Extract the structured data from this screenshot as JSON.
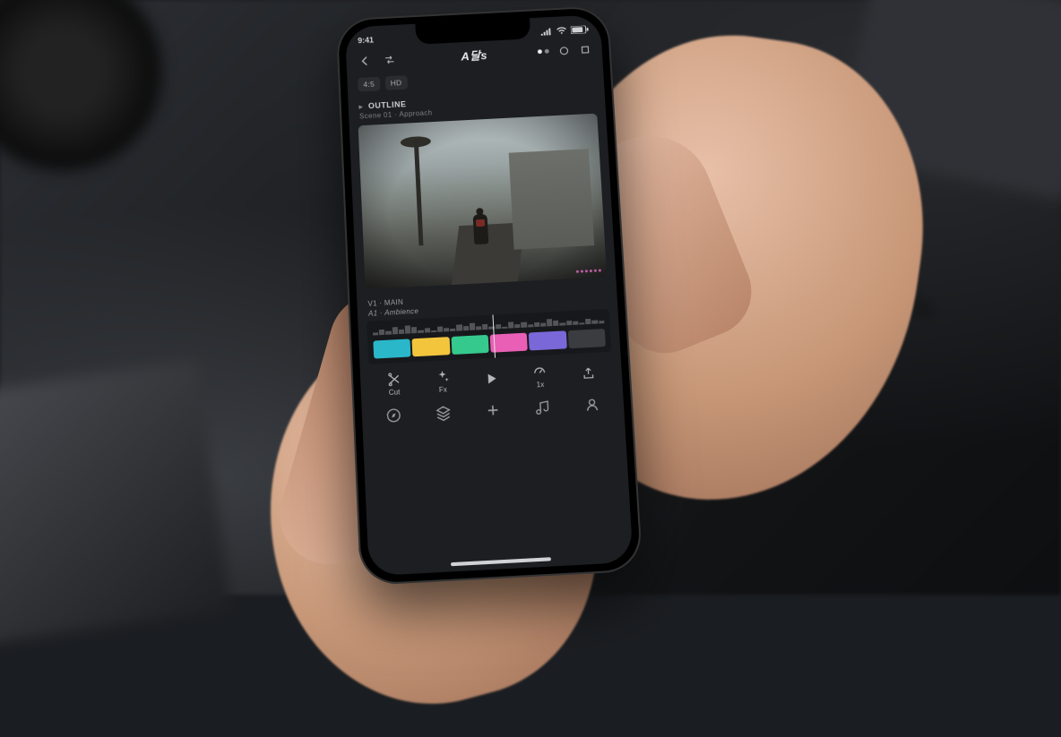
{
  "status": {
    "time": "9:41",
    "battery_pct": 85
  },
  "header": {
    "title": "A달s",
    "back_icon": "chevron-left",
    "secondary_icon": "swap",
    "dots_indicator": {
      "total": 2,
      "active": 0
    },
    "circle_icon": "circle-outline",
    "square_icon": "crop-square"
  },
  "chips": [
    "4:5",
    "HD"
  ],
  "section": {
    "label": "OUTLINE",
    "caret_icon": "chevron-right",
    "sublabel": "Scene 01 · Approach"
  },
  "preview": {
    "description": "figure walking toward ruined colonnade with palm trees at dusk",
    "overlay_dot_count": 6
  },
  "tracks": {
    "line1": "V1 · MAIN",
    "line2": "A1 · Ambience"
  },
  "timeline": {
    "clips": [
      {
        "color": "#2ab7c9"
      },
      {
        "color": "#f2c53d"
      },
      {
        "color": "#36c98e"
      },
      {
        "color": "#e85fb5"
      },
      {
        "color": "#7a68d8"
      },
      {
        "color": "#3a3c40"
      }
    ],
    "playhead_pct": 52,
    "waveform_heights": [
      3,
      6,
      4,
      8,
      5,
      9,
      7,
      3,
      5,
      2,
      6,
      4,
      3,
      7,
      5,
      8,
      4,
      6,
      3,
      5,
      2,
      7,
      4,
      6,
      3,
      5,
      4,
      8,
      6,
      3,
      5,
      4,
      2,
      6,
      4,
      3
    ]
  },
  "tools": [
    {
      "id": "cut",
      "label": "Cut",
      "icon": "scissors"
    },
    {
      "id": "fx",
      "label": "Fx",
      "icon": "sparkle"
    },
    {
      "id": "play",
      "label": "",
      "icon": "play"
    },
    {
      "id": "speed",
      "label": "1x",
      "icon": "gauge"
    },
    {
      "id": "more",
      "label": "",
      "icon": "share"
    }
  ],
  "bottom_tabs": [
    {
      "id": "home",
      "icon": "compass"
    },
    {
      "id": "library",
      "icon": "layers"
    },
    {
      "id": "add",
      "icon": "plus"
    },
    {
      "id": "sound",
      "icon": "music"
    },
    {
      "id": "profile",
      "icon": "person"
    }
  ]
}
